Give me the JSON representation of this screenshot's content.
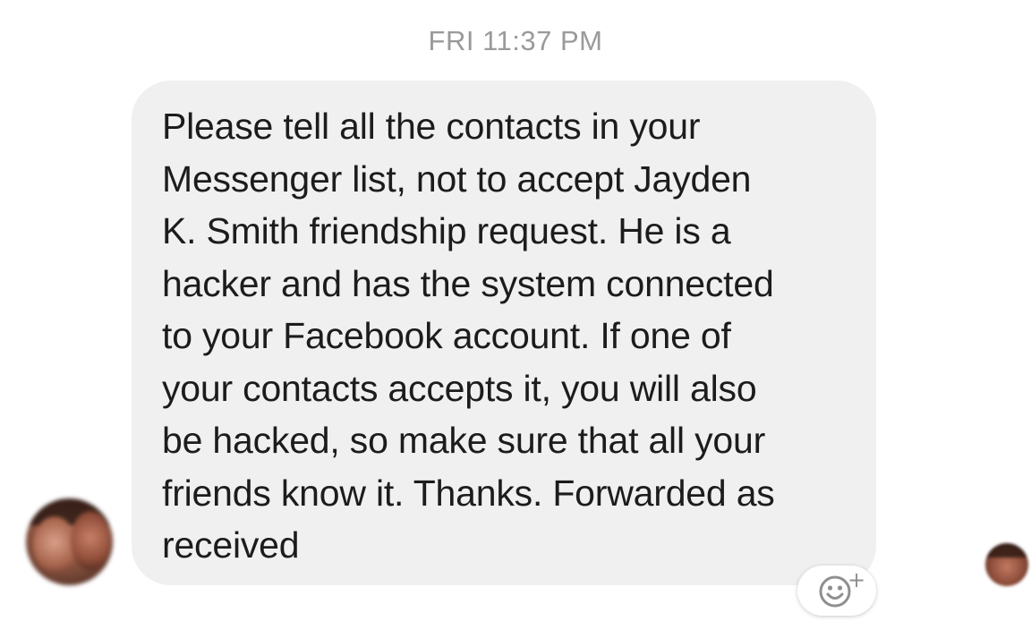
{
  "thread": {
    "timestamp": "FRI 11:37 PM"
  },
  "message": {
    "text": "Please tell all the contacts in your\nMessenger list, not to accept Jayden\nK. Smith friendship request. He is a\nhacker and has the system connected\nto your Facebook account. If one of\nyour contacts accepts it, you will also\nbe hacked, so make sure that all your\nfriends know it. Thanks. Forwarded as\nreceived",
    "bubble_color": "#f0f0f0",
    "text_color": "#1c1c1c"
  },
  "reaction": {
    "icon": "smiley-icon",
    "plus_glyph": "+"
  },
  "colors": {
    "timestamp": "#9a9a9a",
    "background": "#ffffff"
  }
}
